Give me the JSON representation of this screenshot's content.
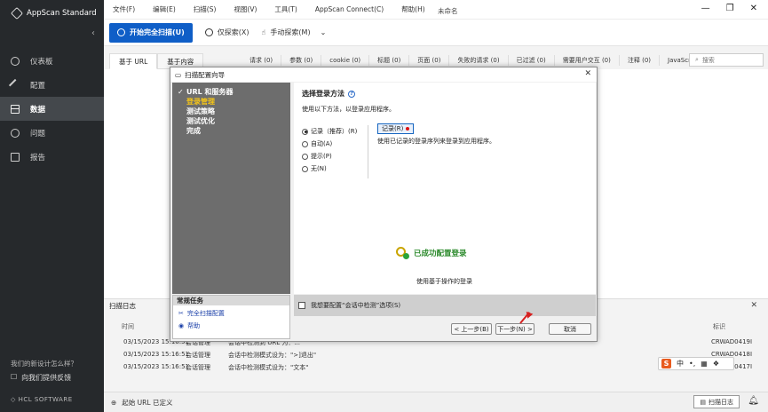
{
  "app": {
    "brand": "AppScan Standard",
    "window_title": "未命名"
  },
  "menu": [
    "文件(F)",
    "编辑(E)",
    "扫描(S)",
    "视图(V)",
    "工具(T)",
    "AppScan Connect(C)",
    "帮助(H)"
  ],
  "toolbar": {
    "full_scan": "开始完全扫描(U)",
    "explore_only": "仅探索(X)",
    "manual_explore": "手动探索(M)"
  },
  "sidebar": {
    "items": [
      {
        "label": "仪表板",
        "icon": "dashboard-icon"
      },
      {
        "label": "配置",
        "icon": "wrench-icon"
      },
      {
        "label": "数据",
        "icon": "data-icon",
        "active": true
      },
      {
        "label": "问题",
        "icon": "issue-icon"
      },
      {
        "label": "报告",
        "icon": "report-icon"
      }
    ],
    "feedback_q": "我们的新设计怎么样？",
    "feedback": "向我们提供反馈",
    "vendor": "HCL SOFTWARE"
  },
  "view_tabs": [
    "基于 URL",
    "基于内容"
  ],
  "filters": [
    "请求 (0)",
    "参数 (0)",
    "cookie (0)",
    "标题 (0)",
    "页面 (0)",
    "失败的请求 (0)",
    "已过滤 (0)",
    "需要用户交互 (0)",
    "注释 (0)",
    "JavaScript (0)"
  ],
  "search": {
    "placeholder": "搜索"
  },
  "log": {
    "title": "扫描日志",
    "col_time": "时间",
    "col_id": "标识",
    "rows": [
      {
        "time": "03/15/2023 15:16:51",
        "cat": "会话管理",
        "msg": "会话中检测到 URL 为：...",
        "id": "CRWAD0419I"
      },
      {
        "time": "03/15/2023 15:16:51",
        "cat": "会话管理",
        "msg": "会话中检测模式设为：\">]退出\"",
        "id": "CRWAD0418I"
      },
      {
        "time": "03/15/2023 15:16:51",
        "cat": "会话管理",
        "msg": "会话中检测模式设为：\"文本\"",
        "id": "CRWAD0417I"
      }
    ]
  },
  "status": {
    "start_url": "起始 URL 已定义",
    "log_button": "扫描日志"
  },
  "dialog": {
    "title": "扫描配置向导",
    "steps": [
      {
        "label": "URL 和服务器",
        "done": true
      },
      {
        "label": "登录管理",
        "current": true
      },
      {
        "label": "测试策略"
      },
      {
        "label": "测试优化"
      },
      {
        "label": "完成"
      }
    ],
    "tasks_title": "常规任务",
    "tasks": [
      "完全扫描配置",
      "帮助"
    ],
    "section_title": "选择登录方法",
    "section_desc": "使用以下方法，以登录应用程序。",
    "radios": [
      {
        "label": "记录（推荐）(R)",
        "checked": true
      },
      {
        "label": "自动(A)"
      },
      {
        "label": "提示(P)"
      },
      {
        "label": "无(N)"
      }
    ],
    "record_button": "记录(R)",
    "record_desc": "使用已记录的登录序列来登录到应用程序。",
    "success_title": "已成功配置登录",
    "success_desc": "使用基于操作的登录",
    "session_checkbox": "我想要配置“会话中检测”选项(S)",
    "back": "< 上一步(B)",
    "next": "下一步(N) >",
    "cancel": "取消"
  },
  "ime": {
    "lang": "中"
  },
  "colors": {
    "primary": "#0f5ec7",
    "sidebar": "#26292c",
    "wizard_bg": "#6d6d6d",
    "current_step": "#f5c518",
    "success": "#2c8a2c",
    "annotation": "#d62020"
  }
}
